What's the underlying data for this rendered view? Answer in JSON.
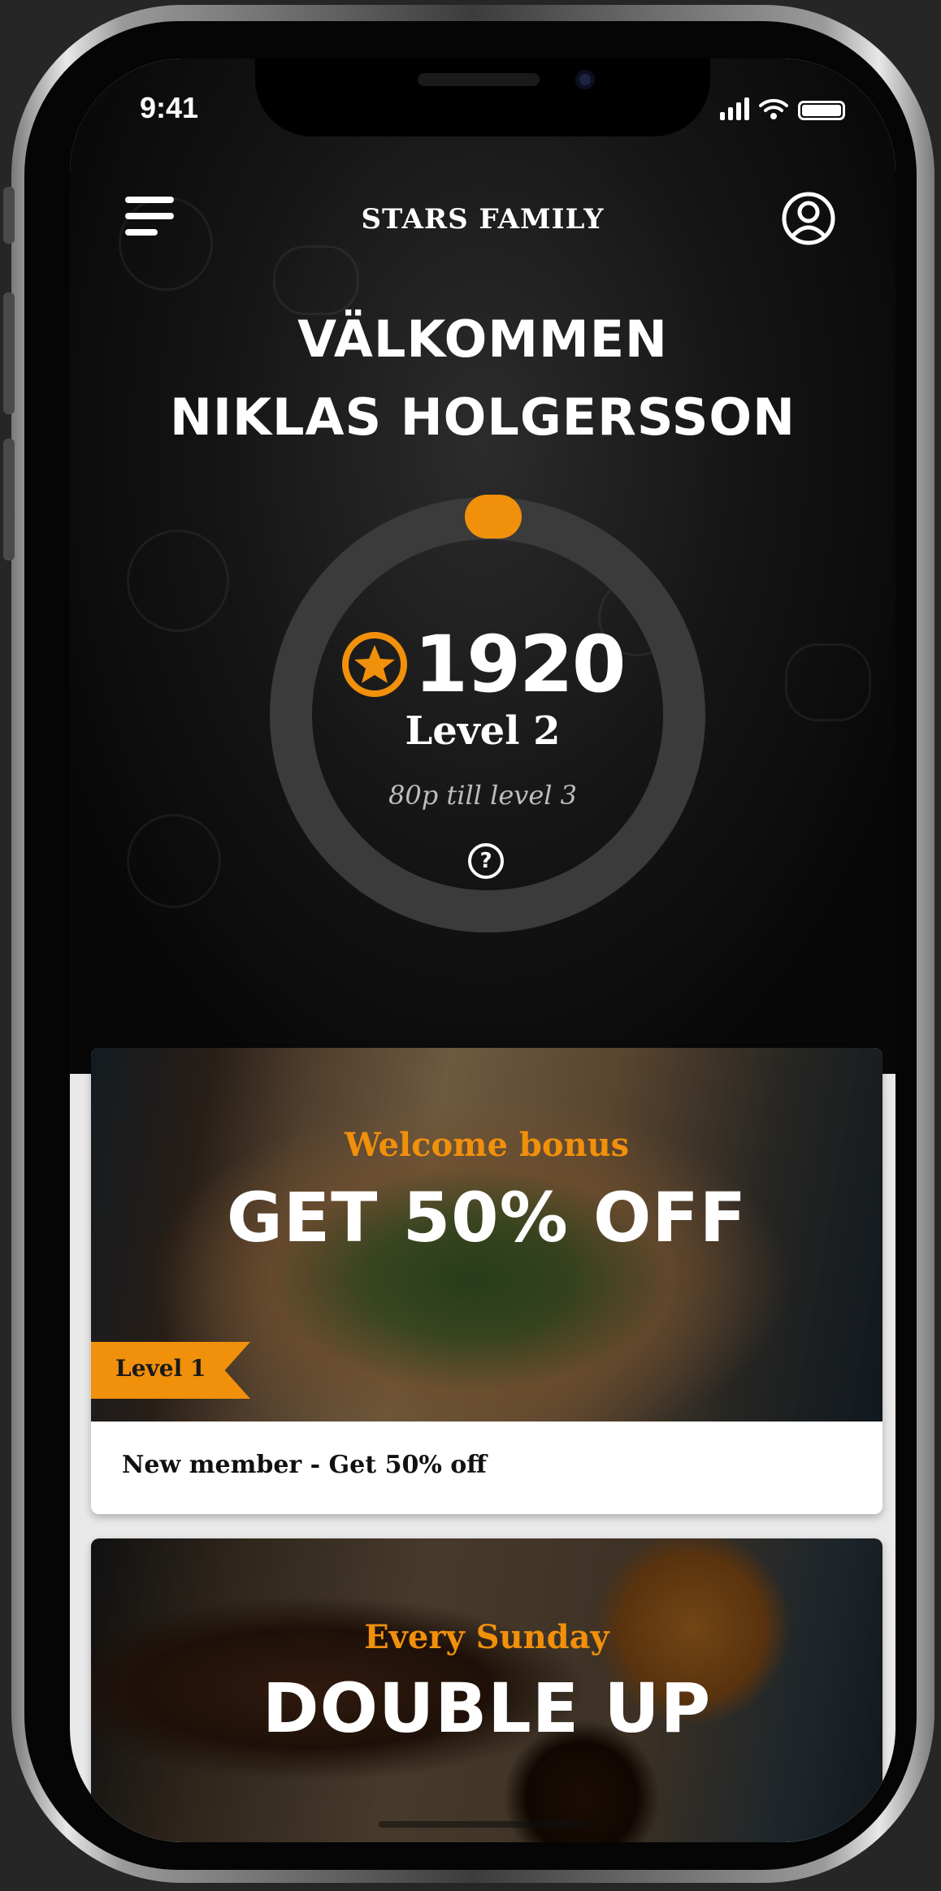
{
  "status_bar": {
    "time": "9:41"
  },
  "header": {
    "app_title": "STARS FAMILY"
  },
  "welcome": {
    "line1": "VÄLKOMMEN",
    "line2": "NIKLAS HOLGERSSON"
  },
  "points_panel": {
    "points": "1920",
    "level": "Level 2",
    "next_level_text": "80p till level 3",
    "help": "?"
  },
  "offers": [
    {
      "subtitle": "Welcome bonus",
      "headline": "GET 50% OFF",
      "level_tag": "Level 1",
      "description": "New member - Get 50% off"
    },
    {
      "subtitle": "Every Sunday",
      "headline": "DOUBLE UP"
    }
  ],
  "colors": {
    "accent": "#f1900b",
    "background": "#0b0b0b",
    "ring": "#3b3b3b"
  }
}
